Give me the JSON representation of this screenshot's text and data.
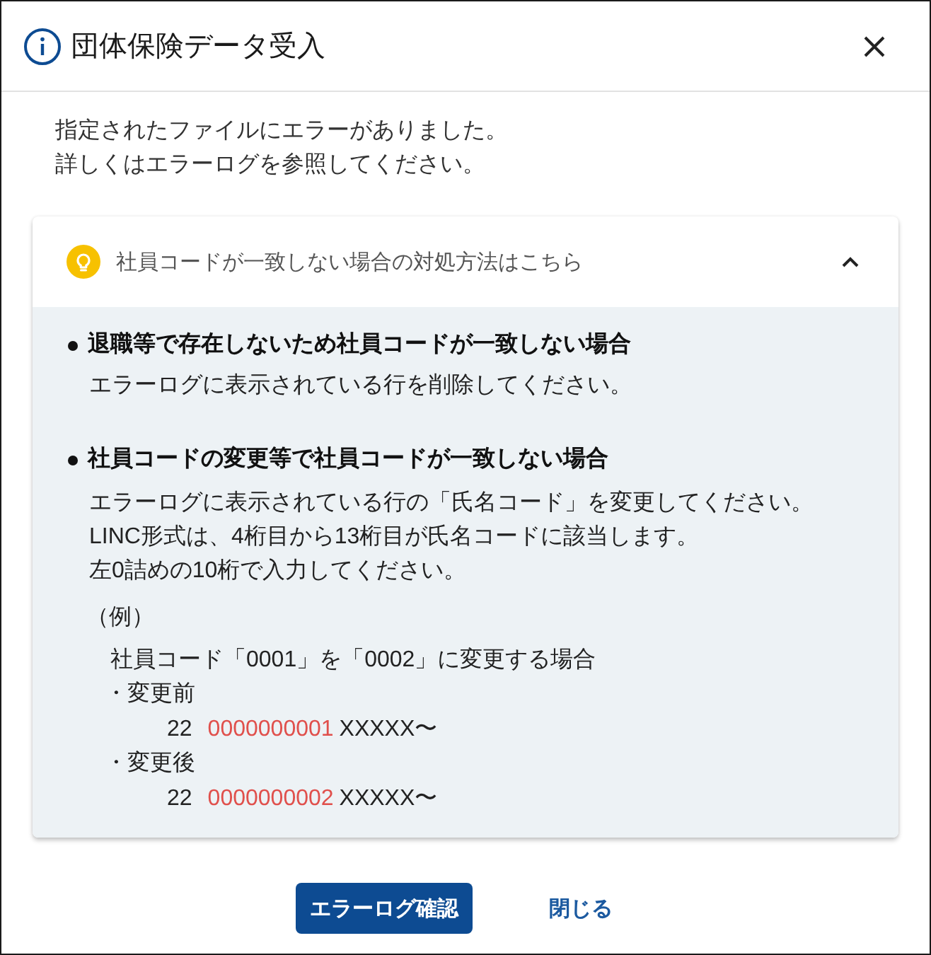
{
  "dialog": {
    "title": "団体保険データ受入"
  },
  "message": [
    "指定されたファイルにエラーがありました。",
    "詳しくはエラーログを参照してください。"
  ],
  "help_panel": {
    "title": "社員コードが一致しない場合の対処方法はこちら",
    "expanded": true,
    "sections": [
      {
        "heading": "退職等で存在しないため社員コードが一致しない場合",
        "lines": [
          "エラーログに表示されている行を削除してください。"
        ]
      },
      {
        "heading": "社員コードの変更等で社員コードが一致しない場合",
        "lines": [
          "エラーログに表示されている行の「氏名コード」を変更してください。",
          "LINC形式は、4桁目から13桁目が氏名コードに該当します。",
          "左0詰めの10桁で入力してください。"
        ],
        "example": {
          "label": "（例）",
          "title": "社員コード「0001」を「0002」に変更する場合",
          "cases": [
            {
              "label": "・変更前",
              "prefix": "22",
              "code": "0000000001",
              "suffix": "XXXXX〜"
            },
            {
              "label": "・変更後",
              "prefix": "22",
              "code": "0000000002",
              "suffix": "XXXXX〜"
            }
          ]
        }
      }
    ]
  },
  "buttons": [
    {
      "label": "エラーログ確認",
      "kind": "primary"
    },
    {
      "label": "閉じる",
      "kind": "text"
    }
  ]
}
